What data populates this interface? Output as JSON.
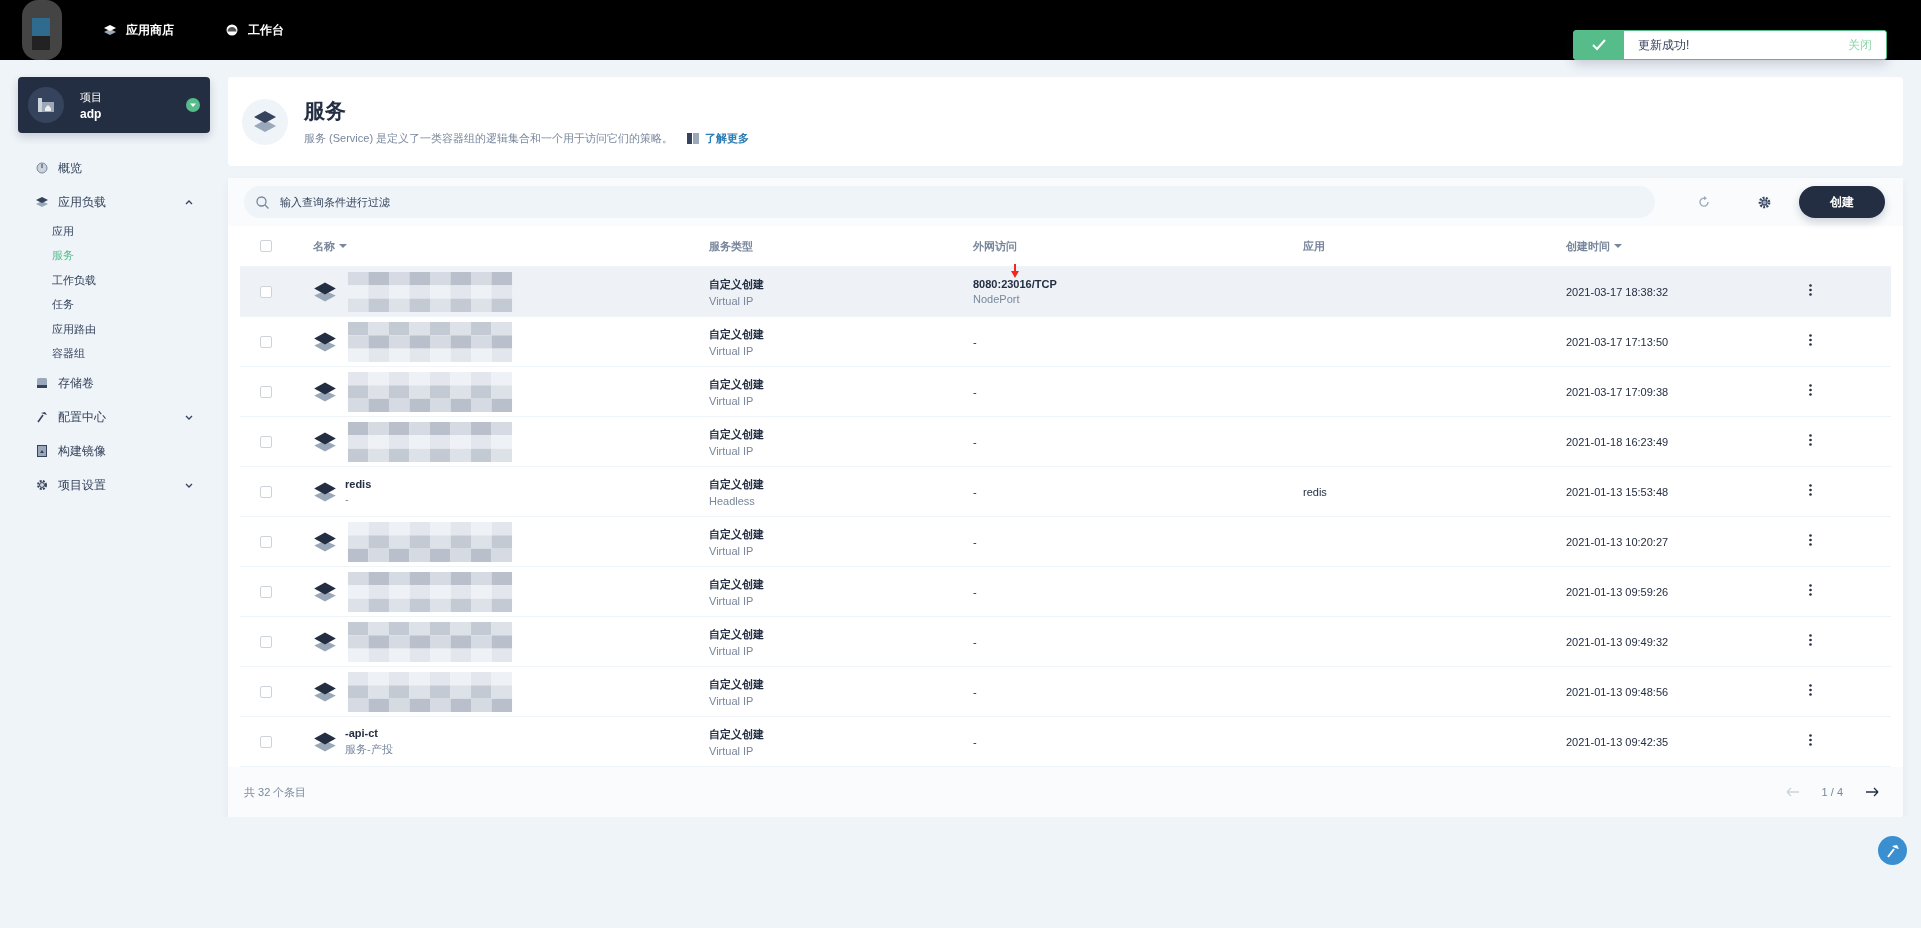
{
  "topbar": {
    "nav": [
      {
        "label": "应用商店",
        "kind": "store"
      },
      {
        "label": "工作台",
        "kind": "workbench"
      }
    ]
  },
  "toast": {
    "message": "更新成功!",
    "close": "关闭"
  },
  "project": {
    "label": "项目",
    "name": "adp"
  },
  "sidebar": {
    "items": [
      {
        "label": "概览",
        "selected": false
      },
      {
        "label": "应用负载",
        "expanded": true,
        "children": [
          {
            "label": "应用",
            "selected": false
          },
          {
            "label": "服务",
            "selected": true
          },
          {
            "label": "工作负载",
            "selected": false
          },
          {
            "label": "任务",
            "selected": false
          },
          {
            "label": "应用路由",
            "selected": false
          },
          {
            "label": "容器组",
            "selected": false
          }
        ]
      },
      {
        "label": "存储卷",
        "selected": false
      },
      {
        "label": "配置中心",
        "expanded": false
      },
      {
        "label": "构建镜像",
        "selected": false
      },
      {
        "label": "项目设置",
        "expanded": false
      }
    ]
  },
  "header": {
    "title": "服务",
    "description": "服务 (Service) 是定义了一类容器组的逻辑集合和一个用于访问它们的策略。",
    "link": "了解更多"
  },
  "toolbar": {
    "search": {
      "placeholder": "输入查询条件进行过滤"
    },
    "create": "创建"
  },
  "table": {
    "all_selected": false,
    "columns": [
      {
        "label": "名称",
        "sortable": true
      },
      {
        "label": "服务类型",
        "sortable": false
      },
      {
        "label": "外网访问",
        "sortable": false
      },
      {
        "label": "应用",
        "sortable": false
      },
      {
        "label": "创建时间",
        "sortable": true
      }
    ],
    "rows": [
      {
        "selected": false,
        "hovered": true,
        "type": "自定义创建",
        "type_sub": "Virtual IP",
        "access": "8080:23016/TCP",
        "access_sub": "NodePort",
        "annotated": true,
        "created": "2021-03-17 18:38:32"
      },
      {
        "selected": false,
        "hovered": false,
        "type": "自定义创建",
        "type_sub": "Virtual IP",
        "access": "-",
        "annotated": false,
        "created": "2021-03-17 17:13:50"
      },
      {
        "selected": false,
        "hovered": false,
        "type": "自定义创建",
        "type_sub": "Virtual IP",
        "access": "-",
        "annotated": false,
        "created": "2021-03-17 17:09:38"
      },
      {
        "selected": false,
        "hovered": false,
        "type": "自定义创建",
        "type_sub": "Virtual IP",
        "access": "-",
        "annotated": false,
        "created": "2021-01-18 16:23:49"
      },
      {
        "selected": false,
        "hovered": false,
        "name": "redis",
        "name_sub": "-",
        "type": "自定义创建",
        "type_sub": "Headless",
        "access": "-",
        "app": "redis",
        "annotated": false,
        "created": "2021-01-13 15:53:48"
      },
      {
        "selected": false,
        "hovered": false,
        "type": "自定义创建",
        "type_sub": "Virtual IP",
        "access": "-",
        "annotated": false,
        "created": "2021-01-13 10:20:27"
      },
      {
        "selected": false,
        "hovered": false,
        "type": "自定义创建",
        "type_sub": "Virtual IP",
        "access": "-",
        "annotated": false,
        "created": "2021-01-13 09:59:26"
      },
      {
        "selected": false,
        "hovered": false,
        "type": "自定义创建",
        "type_sub": "Virtual IP",
        "access": "-",
        "annotated": false,
        "created": "2021-01-13 09:49:32"
      },
      {
        "selected": false,
        "hovered": false,
        "type": "自定义创建",
        "type_sub": "Virtual IP",
        "access": "-",
        "annotated": false,
        "created": "2021-01-13 09:48:56"
      },
      {
        "selected": false,
        "hovered": false,
        "name": "-api-ct",
        "name_sub": "服务-产投",
        "type": "自定义创建",
        "type_sub": "Virtual IP",
        "access": "-",
        "annotated": false,
        "created": "2021-01-13 09:42:35"
      }
    ],
    "total": "共 32 个条目",
    "page": "1 / 4"
  }
}
